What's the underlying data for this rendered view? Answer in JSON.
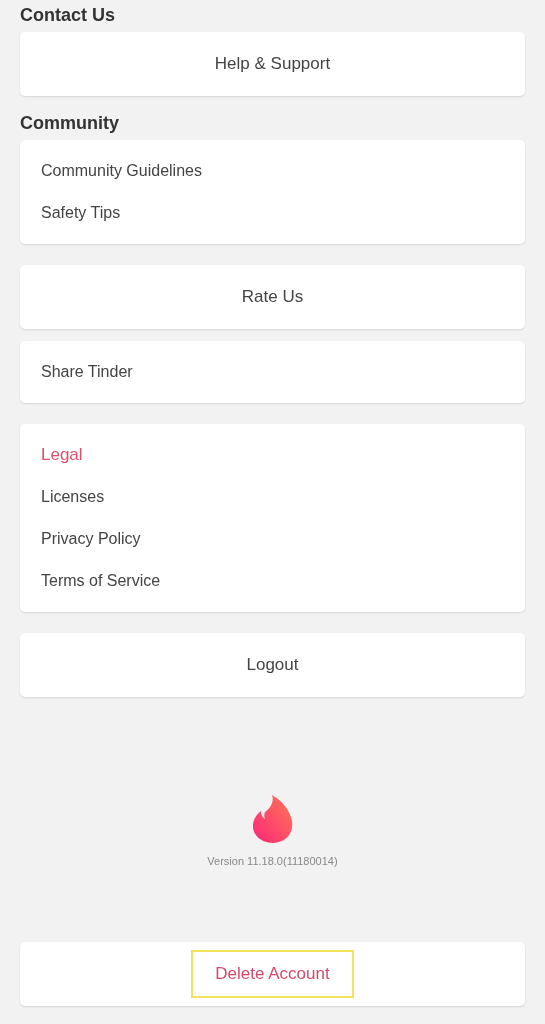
{
  "sections": [
    {
      "kind": "header",
      "text": "Contact Us"
    },
    {
      "kind": "button",
      "label": "Help & Support"
    },
    {
      "kind": "header",
      "text": "Community"
    },
    {
      "kind": "list",
      "items": [
        "Community Guidelines",
        "Safety Tips"
      ]
    },
    {
      "kind": "button",
      "label": "Rate Us"
    },
    {
      "kind": "list",
      "items": [
        "Share Tinder"
      ]
    },
    {
      "kind": "list",
      "title": "Legal",
      "items": [
        "Licenses",
        "Privacy Policy",
        "Terms of Service"
      ]
    },
    {
      "kind": "button",
      "label": "Logout"
    },
    {
      "kind": "footer",
      "version": "Version 11.18.0(11180014)"
    },
    {
      "kind": "danger",
      "label": "Delete Account",
      "highlighted": true
    }
  ]
}
